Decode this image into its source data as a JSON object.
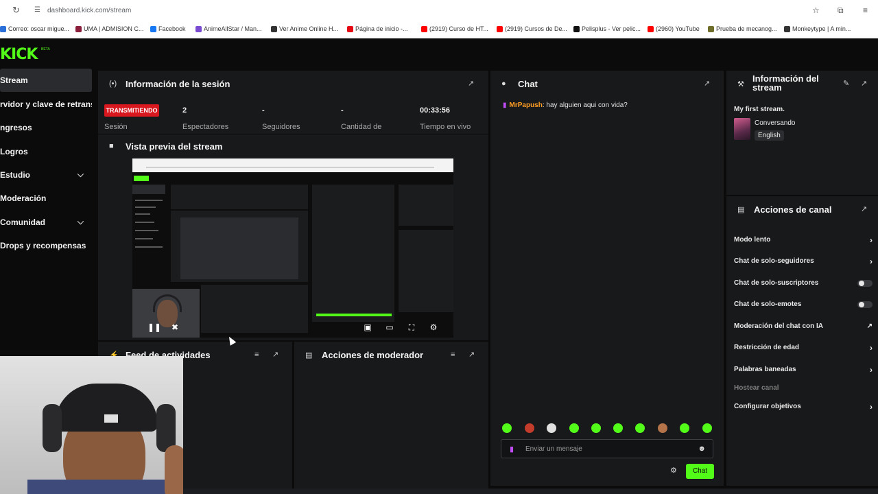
{
  "browser": {
    "url": "dashboard.kick.com/stream",
    "bookmarks": [
      "Correo: oscar migue...",
      "UMA | ADMISION C...",
      "Facebook",
      "AnimeAllStar / Man...",
      "Ver Anime Online H...",
      "Página de inicio -...",
      "(2919) Curso de HT...",
      "(2919) Cursos de De...",
      "Pelisplus - Ver pelic...",
      "(2960) YouTube",
      "Prueba de mecanog...",
      "Monkeytype | A min..."
    ],
    "bookmark_colors": [
      "#2b6fd8",
      "#8a1e3b",
      "#1877f2",
      "#7a4bd1",
      "#333333",
      "#e50914",
      "#ff0000",
      "#ff0000",
      "#111111",
      "#ff0000",
      "#6e6e2a",
      "#333333"
    ]
  },
  "app": {
    "logo": "KICK",
    "logo_badge": "BETA"
  },
  "sidebar": {
    "items": [
      {
        "label": "Stream"
      },
      {
        "label": "rvidor y clave de retransm"
      },
      {
        "label": "ngresos"
      },
      {
        "label": "Logros"
      },
      {
        "label": "Estudio"
      },
      {
        "label": "Moderación"
      },
      {
        "label": "Comunidad"
      },
      {
        "label": "Drops y recompensas"
      }
    ]
  },
  "session": {
    "title": "Información de la sesión",
    "live_badge": "TRANSMITIENDO",
    "session_label": "Sesión",
    "stats": [
      {
        "value": "2",
        "label": "Espectadores"
      },
      {
        "value": "-",
        "label": "Seguidores"
      },
      {
        "value": "-",
        "label": "Cantidad de"
      },
      {
        "value": "00:33:56",
        "label": "Tiempo en vivo"
      }
    ]
  },
  "preview": {
    "title": "Vista previa del stream"
  },
  "activity": {
    "title": "Feed de actividades"
  },
  "moderator": {
    "title": "Acciones de moderador"
  },
  "chat": {
    "title": "Chat",
    "messages": [
      {
        "user": "MrPapush",
        "text": "hay alguien aqui con vida?"
      }
    ],
    "input_placeholder": "Enviar un mensaje",
    "send_label": "Chat",
    "emote_colors": [
      "#53fc18",
      "#c23b2b",
      "#e0e0e0",
      "#53fc18",
      "#53fc18",
      "#53fc18",
      "#53fc18",
      "#b5734a",
      "#53fc18",
      "#53fc18"
    ]
  },
  "stream_info": {
    "title": "Información del stream",
    "stream_title": "My first stream.",
    "category": "Conversando",
    "language": "English"
  },
  "channel_actions": {
    "title": "Acciones de canal",
    "items": [
      {
        "label": "Modo lento",
        "control": "chevron"
      },
      {
        "label": "Chat de solo-seguidores",
        "control": "chevron"
      },
      {
        "label": "Chat de solo-suscriptores",
        "control": "toggle"
      },
      {
        "label": "Chat de solo-emotes",
        "control": "toggle"
      },
      {
        "label": "Moderación del chat con IA",
        "control": "external"
      },
      {
        "label": "Restricción de edad",
        "control": "chevron"
      },
      {
        "label": "Palabras baneadas",
        "control": "chevron"
      },
      {
        "label": "Hostear canal",
        "control": "none"
      },
      {
        "label": "Configurar objetivos",
        "control": "chevron"
      }
    ]
  },
  "colors": {
    "accent": "#53fc18",
    "live": "#d8171f",
    "username": "#ff9f24"
  }
}
